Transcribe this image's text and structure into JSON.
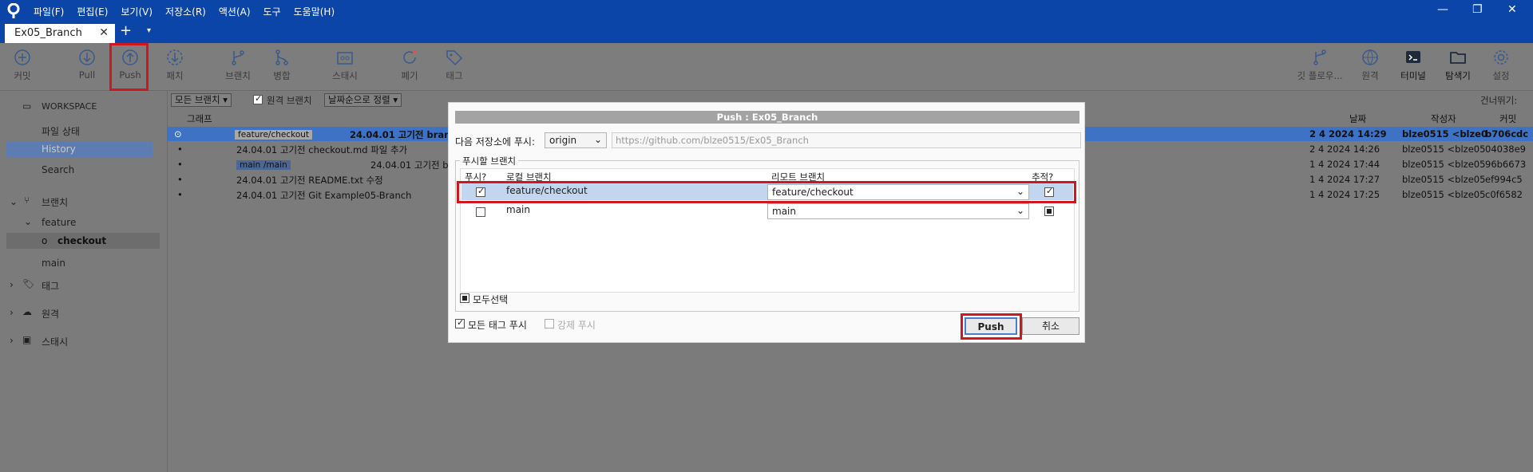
{
  "title_bar": {
    "menus": [
      "파일(F)",
      "편집(E)",
      "보기(V)",
      "저장소(R)",
      "액션(A)",
      "도구",
      "도움말(H)"
    ]
  },
  "tab": {
    "label": "Ex05_Branch",
    "close": "✕",
    "new": "+",
    "menu": "▾"
  },
  "toolbar": {
    "commit": "커밋",
    "pull": "Pull",
    "push": "Push",
    "fetch": "패치",
    "branch": "브랜치",
    "merge": "병합",
    "stash": "스태시",
    "discard": "폐기",
    "tag": "태그",
    "gitflow": "깃 플로우...",
    "remote": "원격",
    "terminal": "터미널",
    "explorer": "탐색기",
    "settings": "설정"
  },
  "sidebar": {
    "workspace": "WORKSPACE",
    "file_status": "파일 상태",
    "history": "History",
    "search": "Search",
    "branches": "브랜치",
    "feature": "feature",
    "checkout": "checkout",
    "main": "main",
    "tags": "태그",
    "remotes": "원격",
    "stashes": "스태시"
  },
  "filter": {
    "branches": "모든 브랜치 ▾",
    "remote_branches": "원격 브랜치",
    "sort": "날짜순으로 정렬 ▾",
    "skip": "건너뛰기:"
  },
  "columns": {
    "graph": "그래프",
    "date": "날짜",
    "author": "작성자",
    "commit": "커밋"
  },
  "commits": [
    {
      "tags": [
        "feature/checkout"
      ],
      "message": "24.04.01 고기전 branc",
      "date": "2 4 2024 14:29",
      "author": "blze0515 <blze0",
      "hash": "b706cdc"
    },
    {
      "tags": [],
      "message": "24.04.01 고기전 checkout.md 파일 추가",
      "date": "2 4 2024 14:26",
      "author": "blze0515 <blze05",
      "hash": "04038e9"
    },
    {
      "tags": [
        "origin/main",
        "main"
      ],
      "message": "24.04.01 고기전 b",
      "date": "1 4 2024 17:44",
      "author": "blze0515 <blze05",
      "hash": "96b6673"
    },
    {
      "tags": [],
      "message": "24.04.01 고기전 README.txt 수정",
      "date": "1 4 2024 17:27",
      "author": "blze0515 <blze05",
      "hash": "ef994c5"
    },
    {
      "tags": [],
      "message": "24.04.01 고기전 Git Example05-Branch",
      "date": "1 4 2024 17:25",
      "author": "blze0515 <blze05",
      "hash": "c0f6582"
    }
  ],
  "dialog": {
    "title": "Push : Ex05_Branch",
    "push_to_label": "다음 저장소에 푸시:",
    "remote": "origin",
    "url": "https://github.com/blze0515/Ex05_Branch",
    "branches_group": "푸시할 브랜치",
    "col_push": "푸시?",
    "col_local": "로컬 브랜치",
    "col_remote": "리모트 브랜치",
    "col_track": "추적?",
    "rows": [
      {
        "local": "feature/checkout",
        "remote": "feature/checkout",
        "push": true,
        "track": true
      },
      {
        "local": "main",
        "remote": "main",
        "push": false,
        "track": "indeterminate"
      }
    ],
    "select_all": "모두선택",
    "push_all_tags": "모든 태그 푸시",
    "force_push": "강제 푸시",
    "push_button": "Push",
    "cancel_button": "취소"
  },
  "colors": {
    "titlebar": "#0b45a8",
    "highlight": "#d0161f",
    "selection": "#3e72c4"
  }
}
